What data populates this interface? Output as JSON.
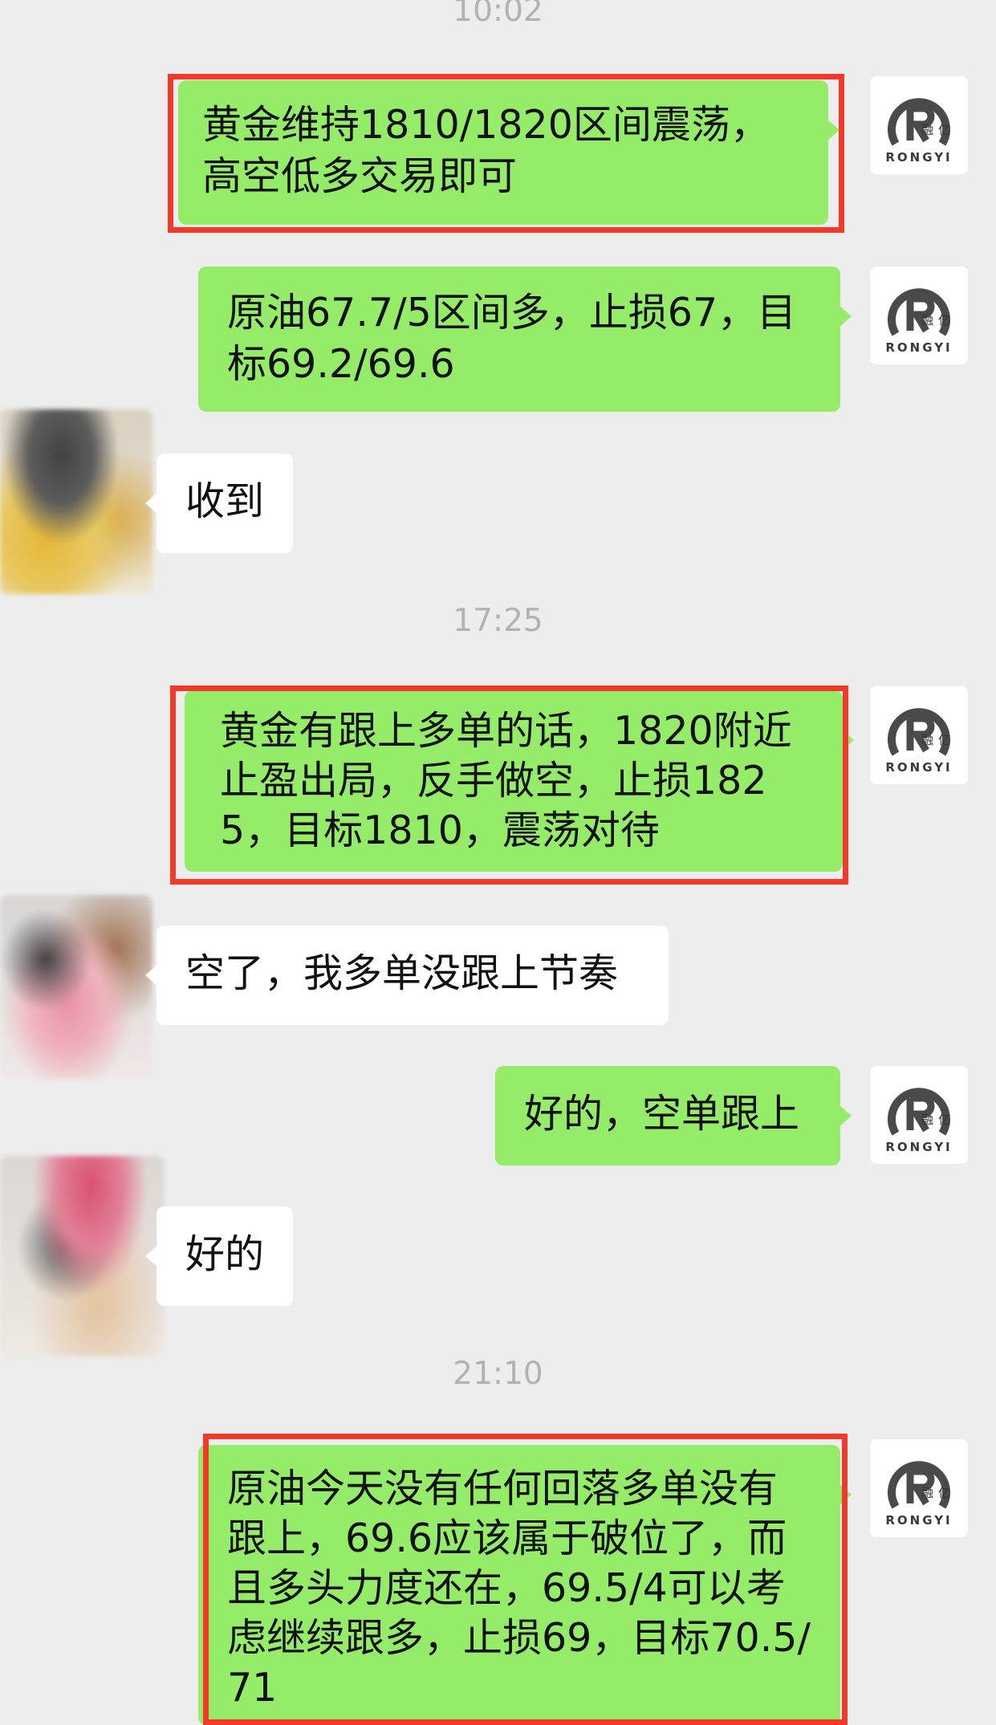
{
  "timestamps": [
    "10:02",
    "17:25",
    "21:10"
  ],
  "avatar": {
    "self_brand": "RONGYI",
    "self_brand_cn": "融亿",
    "self_icon": "rongyi-logo-icon",
    "others_icon": "blurred-avatar-icon"
  },
  "messages": [
    {
      "side": "out",
      "text": "黄金维持1810/1820区间震荡，高空低多交易即可",
      "highlighted": true
    },
    {
      "side": "out",
      "text": "原油67.7/5区间多，止损67，目标69.2/69.6",
      "highlighted": false
    },
    {
      "side": "in",
      "text": "收到"
    },
    {
      "side": "out",
      "text": "黄金有跟上多单的话，1820附近止盈出局，反手做空，止损1825，目标1810，震荡对待",
      "highlighted": true
    },
    {
      "side": "in",
      "text": "空了，我多单没跟上节奏"
    },
    {
      "side": "out",
      "text": "好的，空单跟上",
      "highlighted": false
    },
    {
      "side": "in",
      "text": "好的"
    },
    {
      "side": "out",
      "text": "原油今天没有任何回落多单没有跟上，69.6应该属于破位了，而且多头力度还在，69.5/4可以考虑继续跟多，止损69，目标70.5/71",
      "highlighted": true
    }
  ],
  "colors": {
    "background": "#EDEDED",
    "outgoing_bubble": "#95EC69",
    "incoming_bubble": "#FFFFFF",
    "highlight_border": "#F23A2B",
    "timestamp": "#B2B2B2"
  }
}
